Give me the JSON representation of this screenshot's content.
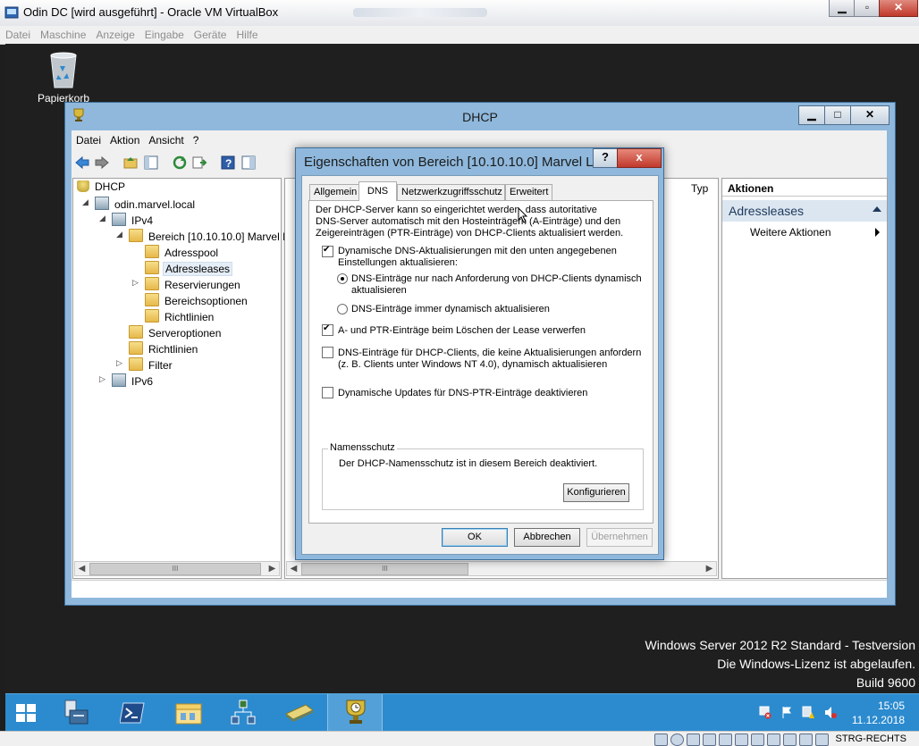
{
  "host": {
    "title": "Odin DC [wird ausgeführt] - Oracle VM VirtualBox",
    "menu": [
      "Datei",
      "Maschine",
      "Anzeige",
      "Eingabe",
      "Geräte",
      "Hilfe"
    ],
    "hostkey": "STRG-RECHTS"
  },
  "desktop": {
    "recycle_bin_label": "Papierkorb",
    "watermark": [
      "Windows Server 2012 R2 Standard - Testversion",
      "Die Windows-Lizenz ist abgelaufen.",
      "Build 9600"
    ]
  },
  "mmc": {
    "title": "DHCP",
    "menu": [
      "Datei",
      "Aktion",
      "Ansicht",
      "?"
    ],
    "tree": {
      "root": "DHCP",
      "server": "odin.marvel.local",
      "ipv4": "IPv4",
      "scope": "Bereich [10.10.10.0] Marvel L",
      "address_pool": "Adresspool",
      "address_leases": "Adressleases",
      "reservations": "Reservierungen",
      "scope_options": "Bereichsoptionen",
      "scope_policies": "Richtlinien",
      "server_options": "Serveroptionen",
      "policies": "Richtlinien",
      "filters": "Filter",
      "ipv6": "IPv6"
    },
    "center_col_typ": "Typ",
    "actions": {
      "header": "Aktionen",
      "section": "Adressleases",
      "more": "Weitere Aktionen"
    },
    "scroll_thumb": "III"
  },
  "dialog": {
    "title": "Eigenschaften von Bereich [10.10.10.0] Marvel L...",
    "help": "?",
    "close": "x",
    "tabs": [
      "Allgemein",
      "DNS",
      "Netzwerkzugriffsschutz",
      "Erweitert"
    ],
    "intro": [
      "Der DHCP-Server kann so eingerichtet werden, dass autoritative",
      "DNS-Server automatisch mit den Hosteinträgern (A-Einträge) und den",
      "Zeigereinträgen (PTR-Einträge) von DHCP-Clients aktualisiert werden."
    ],
    "opt_dynamic": [
      "Dynamische DNS-Aktualisierungen mit den unten angegebenen",
      "Einstellungen aktualisieren:"
    ],
    "radio_on_request": [
      "DNS-Einträge nur nach Anforderung von DHCP-Clients dynamisch",
      "aktualisieren"
    ],
    "radio_always": "DNS-Einträge immer dynamisch aktualisieren",
    "opt_discard": "A- und PTR-Einträge beim Löschen der Lease verwerfen",
    "opt_legacy": [
      "DNS-Einträge für DHCP-Clients, die keine Aktualisierungen anfordern",
      "(z. B. Clients unter Windows NT 4.0), dynamisch aktualisieren"
    ],
    "opt_disable_ptr": "Dynamische Updates für DNS-PTR-Einträge deaktivieren",
    "name_protection": {
      "legend": "Namensschutz",
      "text": "Der DHCP-Namensschutz ist in diesem Bereich deaktiviert.",
      "button": "Konfigurieren"
    },
    "buttons": {
      "ok": "OK",
      "cancel": "Abbrechen",
      "apply": "Übernehmen"
    }
  },
  "taskbar": {
    "time": "15:05",
    "date": "11.12.2018"
  }
}
